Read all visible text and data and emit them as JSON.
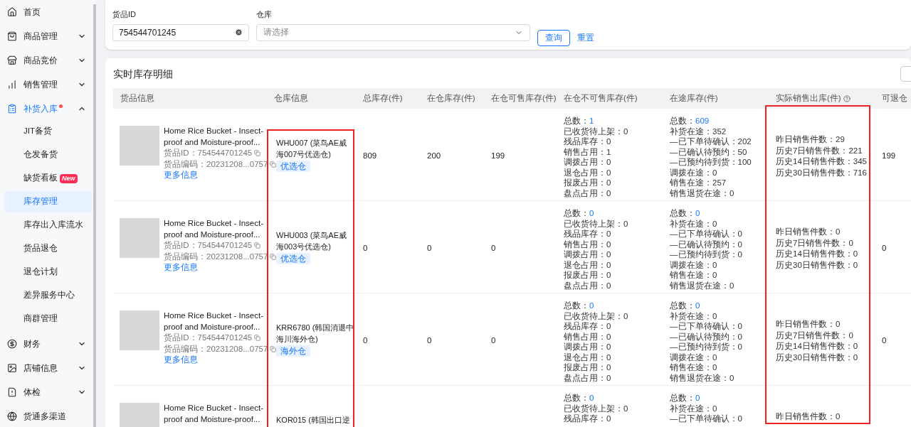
{
  "sidebar": {
    "items": [
      {
        "label": "首页",
        "selected": false
      },
      {
        "label": "商品管理",
        "selected": false,
        "expanded": false
      },
      {
        "label": "商品竞价",
        "selected": false,
        "expanded": false
      },
      {
        "label": "销售管理",
        "selected": false,
        "expanded": false
      },
      {
        "label": "补货入库",
        "selected": true,
        "expanded": true,
        "dot": true,
        "children": [
          {
            "label": "JIT备货",
            "selected": false
          },
          {
            "label": "仓发备货",
            "selected": false
          },
          {
            "label": "缺货看板",
            "selected": false,
            "badge": "New"
          },
          {
            "label": "库存管理",
            "selected": true
          },
          {
            "label": "库存出入库流水",
            "selected": false
          },
          {
            "label": "货品退仓",
            "selected": false
          },
          {
            "label": "退仓计划",
            "selected": false
          },
          {
            "label": "差异服务中心",
            "selected": false
          },
          {
            "label": "商群管理",
            "selected": false
          }
        ]
      },
      {
        "label": "财务",
        "selected": false,
        "expanded": false
      },
      {
        "label": "店铺信息",
        "selected": false,
        "expanded": false
      },
      {
        "label": "体检",
        "selected": false,
        "expanded": false
      },
      {
        "label": "货通多渠道",
        "selected": false
      }
    ]
  },
  "filters": {
    "product_id": {
      "label": "货品ID",
      "value": "754544701245"
    },
    "warehouse": {
      "label": "仓库",
      "placeholder": "请选择"
    },
    "query_button": "查询",
    "reset_link": "重置"
  },
  "table": {
    "title": "实时库存明细",
    "columns": [
      {
        "label": "货品信息"
      },
      {
        "label": "仓库信息"
      },
      {
        "label": "总库存(件)"
      },
      {
        "label": "在仓库存(件)"
      },
      {
        "label": "在仓可售库存(件)"
      },
      {
        "label": "在仓不可售库存(件)"
      },
      {
        "label": "在途库存(件)"
      },
      {
        "label": "实际销售出库(件)",
        "help": true
      },
      {
        "label": "可退仓"
      }
    ],
    "rows": [
      {
        "product": {
          "title": "Home Rice Bucket - Insect-proof and Moisture-proof...",
          "id": "货品ID：754544701245",
          "code": "货品编码：20231208...0757",
          "more": "更多信息"
        },
        "warehouse": {
          "name": "WHU007 (菜鸟AE威海007号优选仓)",
          "tag": "优选仓"
        },
        "total": "809",
        "in_warehouse": "200",
        "sellable": "199",
        "unsellable": {
          "total_label": "总数：",
          "total": "1",
          "lines": [
            "已收货待上架：0",
            "残品库存：0",
            "销售占用：1",
            "调拨占用：0",
            "退仓占用：0",
            "报废占用：0",
            "盘点占用：0"
          ]
        },
        "in_transit": {
          "total_label": "总数：",
          "total": "609",
          "lines": [
            "补货在途：352",
            "—已下单待确认：202",
            "—已确认待预约：50",
            "—已预约待到货：100",
            "调拨在途：0",
            "销售在途：257",
            "销售退货在途：0"
          ]
        },
        "sales": [
          "昨日销售件数：29",
          "历史7日销售件数：221",
          "历史14日销售件数：345",
          "历史30日销售件数：716"
        ],
        "returnable": "199"
      },
      {
        "product": {
          "title": "Home Rice Bucket - Insect-proof and Moisture-proof...",
          "id": "货品ID：754544701245",
          "code": "货品编码：20231208...0757",
          "more": "更多信息"
        },
        "warehouse": {
          "name": "WHU003 (菜鸟AE威海003号优选仓)",
          "tag": "优选仓"
        },
        "total": "0",
        "in_warehouse": "0",
        "sellable": "0",
        "unsellable": {
          "total_label": "总数：",
          "total": "0",
          "lines": [
            "已收货待上架：0",
            "残品库存：0",
            "销售占用：0",
            "调拨占用：0",
            "退仓占用：0",
            "报废占用：0",
            "盘点占用：0"
          ]
        },
        "in_transit": {
          "total_label": "总数：",
          "total": "0",
          "lines": [
            "补货在途：0",
            "—已下单待确认：0",
            "—已确认待预约：0",
            "—已预约待到货：0",
            "调拨在途：0",
            "销售在途：0",
            "销售退货在途：0"
          ]
        },
        "sales": [
          "昨日销售件数：0",
          "历史7日销售件数：0",
          "历史14日销售件数：0",
          "历史30日销售件数：0"
        ],
        "returnable": "0"
      },
      {
        "product": {
          "title": "Home Rice Bucket - Insect-proof and Moisture-proof...",
          "id": "货品ID：754544701245",
          "code": "货品编码：20231208...0757",
          "more": "更多信息"
        },
        "warehouse": {
          "name": "KRR6780 (韩国消退中海川海外仓)",
          "tag": "海外仓"
        },
        "total": "0",
        "in_warehouse": "0",
        "sellable": "0",
        "unsellable": {
          "total_label": "总数：",
          "total": "0",
          "lines": [
            "已收货待上架：0",
            "残品库存：0",
            "销售占用：0",
            "调拨占用：0",
            "退仓占用：0",
            "报废占用：0",
            "盘点占用：0"
          ]
        },
        "in_transit": {
          "total_label": "总数：",
          "total": "0",
          "lines": [
            "补货在途：0",
            "—已下单待确认：0",
            "—已确认待预约：0",
            "—已预约待到货：0",
            "调拨在途：0",
            "销售在途：0",
            "销售退货在途：0"
          ]
        },
        "sales": [
          "昨日销售件数：0",
          "历史7日销售件数：0",
          "历史14日销售件数：0",
          "历史30日销售件数：0"
        ],
        "returnable": "0"
      },
      {
        "product": {
          "title": "Home Rice Bucket - Insect-proof and Moisture-proof..."
        },
        "warehouse": {
          "name": "KOR015 (韩国出口逆"
        },
        "unsellable": {
          "total_label": "总数：",
          "total": "0",
          "lines": [
            "已收货待上架：0",
            "残品库存：0"
          ]
        },
        "in_transit": {
          "total_label": "总数：",
          "total": "0",
          "lines": [
            "补货在途：0",
            "—已下单待确认：0"
          ]
        },
        "sales": [
          "昨日销售件数：0"
        ]
      }
    ]
  }
}
